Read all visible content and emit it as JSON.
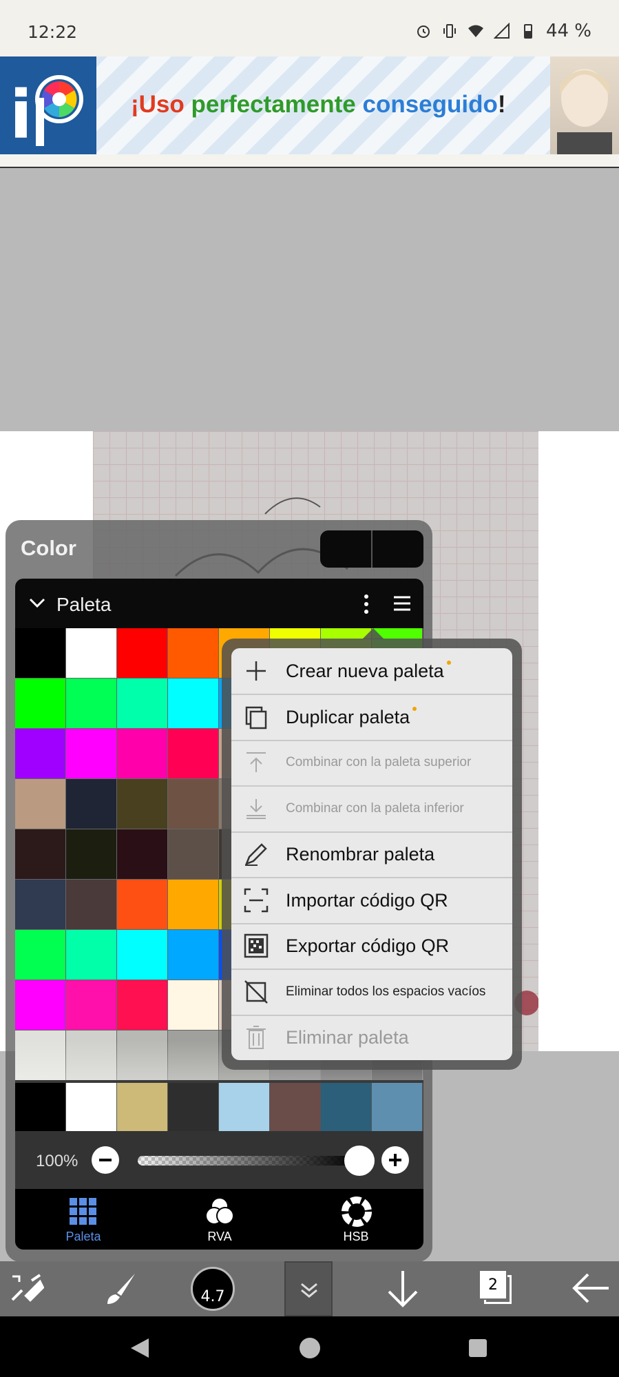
{
  "status_bar": {
    "time": "12:22",
    "battery": "44 %"
  },
  "banner": {
    "part1": "¡Uso ",
    "part2": "perfectamente ",
    "part3": "conseguido",
    "part4": "!",
    "colors": {
      "part1": "#e23a1f",
      "part2": "#2f9b2a",
      "part3": "#2b7ed6",
      "part4": "#222222"
    }
  },
  "color_panel": {
    "title": "Color",
    "palette_label": "Paleta",
    "opacity": "100%",
    "tabs": [
      {
        "label": "Paleta",
        "active": true
      },
      {
        "label": "RVA",
        "active": false
      },
      {
        "label": "HSB",
        "active": false
      }
    ],
    "palette_colors": [
      "#000000",
      "#ffffff",
      "#ff0000",
      "#ff5a00",
      "#ffa800",
      "#f0ff00",
      "#a8ff00",
      "#50ff00",
      "#00ff00",
      "#00ff55",
      "#00ffaa",
      "#00ffff",
      "#00a8ff",
      "#0055ff",
      "#0000ff",
      "#5500ff",
      "#a000ff",
      "#ff00ff",
      "#ff00aa",
      "#ff0055",
      "#c8a28c",
      "#9a7c6a",
      "#6e5a4c",
      "#50463c",
      "#bb9a82",
      "#1f2534",
      "#48401e",
      "#6e5244",
      "#8a7a6a",
      "#50503c",
      "#302828",
      "#201a18",
      "#2c1a1a",
      "#1c1e10",
      "#2a1016",
      "#5c5048",
      "#403830",
      "#383028",
      "#302820",
      "#282018",
      "#303a50",
      "#4a3a3a",
      "#ff5014",
      "#ffa800",
      "#d0d000",
      "#90c800",
      "#50a000",
      "#205000",
      "#00ff50",
      "#00ffa8",
      "#00ffff",
      "#00a8ff",
      "#0050ff",
      "#0000ff",
      "#5000ff",
      "#a000ff",
      "#ff00ff",
      "#ff10aa",
      "#ff1050",
      "#fff6e4",
      "#e0d0c0",
      "#c0b0a0",
      "#a09080",
      "#807060",
      "#e0e0dc",
      "#d0d0cc",
      "#b8b8b4",
      "#a0a09c",
      "#888884",
      "#707070",
      "#585858",
      "#404040"
    ],
    "recent_colors": [
      "#000000",
      "#ffffff",
      "#cdba78",
      "#2e2e2e",
      "#a7d2ea",
      "#6a4c48",
      "#2b5f7a",
      "#5e8faf"
    ]
  },
  "menu": {
    "items": [
      {
        "label": "Crear nueva paleta",
        "icon": "plus-icon",
        "enabled": true,
        "size": "large",
        "dot": true
      },
      {
        "label": "Duplicar paleta",
        "icon": "duplicate-icon",
        "enabled": true,
        "size": "large",
        "dot": true
      },
      {
        "label": "Combinar con la paleta superior",
        "icon": "merge-up-icon",
        "enabled": false,
        "size": "small",
        "dot": false
      },
      {
        "label": "Combinar con la paleta inferior",
        "icon": "merge-down-icon",
        "enabled": false,
        "size": "small",
        "dot": false
      },
      {
        "label": "Renombrar paleta",
        "icon": "pencil-icon",
        "enabled": true,
        "size": "large",
        "dot": false
      },
      {
        "label": "Importar código QR",
        "icon": "scan-qr-icon",
        "enabled": true,
        "size": "large",
        "dot": false
      },
      {
        "label": "Exportar código QR",
        "icon": "qr-code-icon",
        "enabled": true,
        "size": "large",
        "dot": false
      },
      {
        "label": "Eliminar todos los espacios vacíos",
        "icon": "remove-empty-icon",
        "enabled": true,
        "size": "small",
        "dot": false
      },
      {
        "label": "Eliminar paleta",
        "icon": "trash-icon",
        "enabled": false,
        "size": "large",
        "dot": false
      }
    ]
  },
  "toolbar": {
    "brush_size": "4.7",
    "layer_count": "2"
  }
}
